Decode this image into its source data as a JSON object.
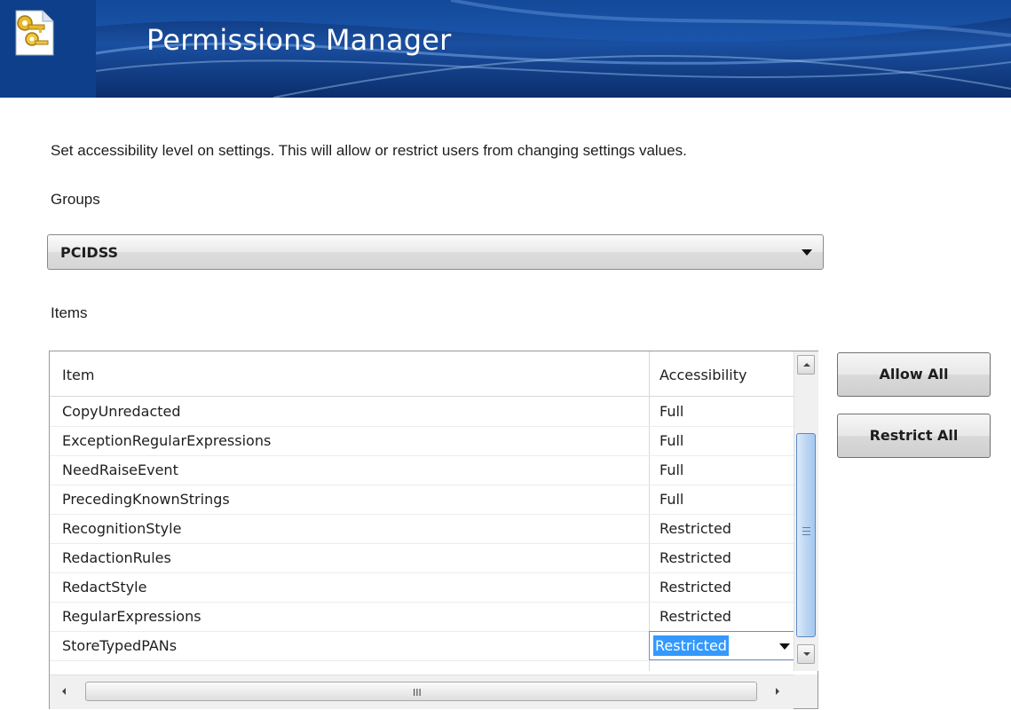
{
  "header": {
    "title": "Permissions Manager",
    "icon": "keys-document-icon"
  },
  "description": "Set accessibility level  on settings.  This will allow or restrict users from changing settings values.",
  "groups": {
    "label": "Groups",
    "selected": "PCIDSS"
  },
  "items": {
    "label": "Items",
    "columns": [
      "Item",
      "Accessibility"
    ],
    "rows": [
      {
        "item": "CopyUnredacted",
        "accessibility": "Full"
      },
      {
        "item": "ExceptionRegularExpressions",
        "accessibility": "Full"
      },
      {
        "item": "NeedRaiseEvent",
        "accessibility": "Full"
      },
      {
        "item": "PrecedingKnownStrings",
        "accessibility": "Full"
      },
      {
        "item": "RecognitionStyle",
        "accessibility": "Restricted"
      },
      {
        "item": "RedactionRules",
        "accessibility": "Restricted"
      },
      {
        "item": "RedactStyle",
        "accessibility": "Restricted"
      },
      {
        "item": "RegularExpressions",
        "accessibility": "Restricted"
      },
      {
        "item": "StoreTypedPANs",
        "accessibility": "Restricted"
      }
    ]
  },
  "buttons": {
    "allow_all": "Allow All",
    "restrict_all": "Restrict All"
  },
  "scrollbar": {
    "hgrip": "III"
  }
}
